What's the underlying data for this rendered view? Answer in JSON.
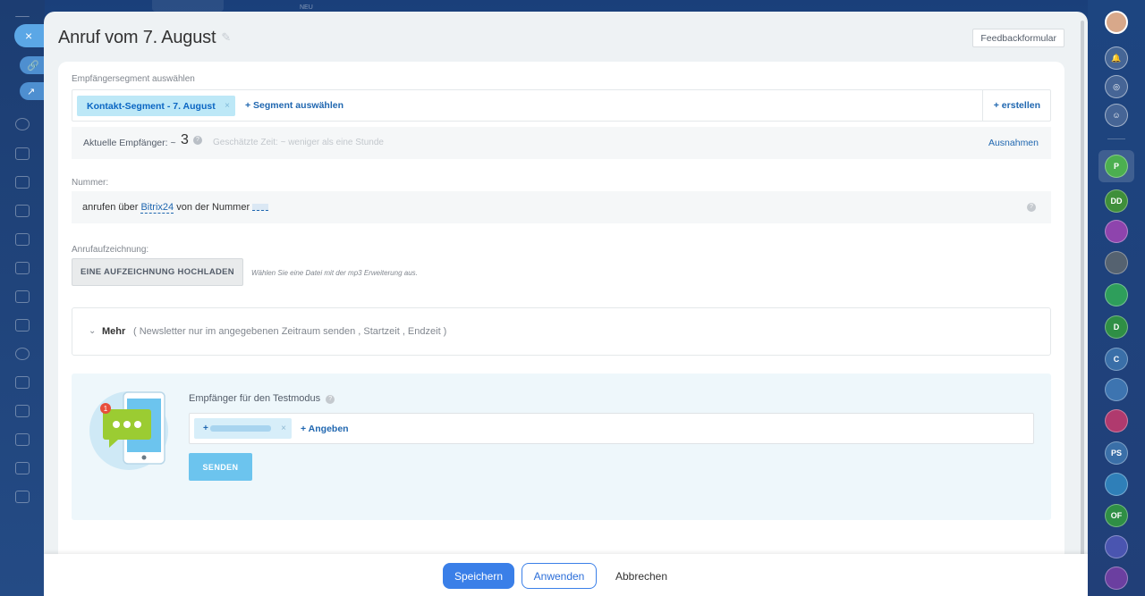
{
  "window": {
    "title": "Anruf vom 7. August",
    "feedback_label": "Feedbackformular",
    "bg_top_label": "NEU"
  },
  "segment": {
    "label": "Empfängersegment auswählen",
    "tag": "Kontakt-Segment - 7. August",
    "tag_remove": "×",
    "add_label": "+ Segment auswählen",
    "create_label": "+ erstellen"
  },
  "recipients": {
    "label": "Aktuelle Empfänger: ~",
    "count": "3",
    "help": "?",
    "estimate": "Geschätzte Zeit: ~ weniger als eine Stunde",
    "exclusions": "Ausnahmen"
  },
  "number": {
    "label": "Nummer:",
    "prefix": "anrufen über",
    "provider": "Bitrix24",
    "middle": "von der Nummer",
    "help": "?"
  },
  "recording": {
    "label": "Anrufaufzeichnung:",
    "upload_label": "EINE AUFZEICHNUNG HOCHLADEN",
    "hint": "Wählen Sie eine Datei mit der mp3 Erweiterung aus."
  },
  "more": {
    "title": "Mehr",
    "options": "( Newsletter nur im angegebenen Zeitraum senden ,  Startzeit ,  Endzeit  )"
  },
  "test": {
    "label": "Empfänger für den Testmodus",
    "help": "?",
    "tag_prefix": "+",
    "tag_remove": "×",
    "add_label": "+ Angeben",
    "send_label": "SENDEN",
    "badge": "1"
  },
  "footer": {
    "save": "Speichern",
    "apply": "Anwenden",
    "cancel": "Abbrechen"
  },
  "right_panel": {
    "items": [
      {
        "initials": "P",
        "color": "#4caf50"
      },
      {
        "initials": "DD",
        "color": "#3f8f3a"
      },
      {
        "initials": "",
        "color": "#8e44ad"
      },
      {
        "initials": "",
        "color": "#556270"
      },
      {
        "initials": "",
        "color": "#2e9e5b"
      },
      {
        "initials": "D",
        "color": "#2f8f45"
      },
      {
        "initials": "C",
        "color": "#3a6fa8"
      },
      {
        "initials": "",
        "color": "#3d74b0"
      },
      {
        "initials": "",
        "color": "#b03a6e"
      },
      {
        "initials": "PS",
        "color": "#3a6fa8"
      },
      {
        "initials": "",
        "color": "#2f7fb8"
      },
      {
        "initials": "OF",
        "color": "#2f8f45"
      },
      {
        "initials": "",
        "color": "#4a55b0"
      },
      {
        "initials": "",
        "color": "#6b3fa0"
      }
    ]
  },
  "colors": {
    "accent": "#2067b0",
    "primary_button": "#3a7fe8",
    "send_button": "#6cc4ee",
    "tag_bg": "#bde8f7"
  }
}
